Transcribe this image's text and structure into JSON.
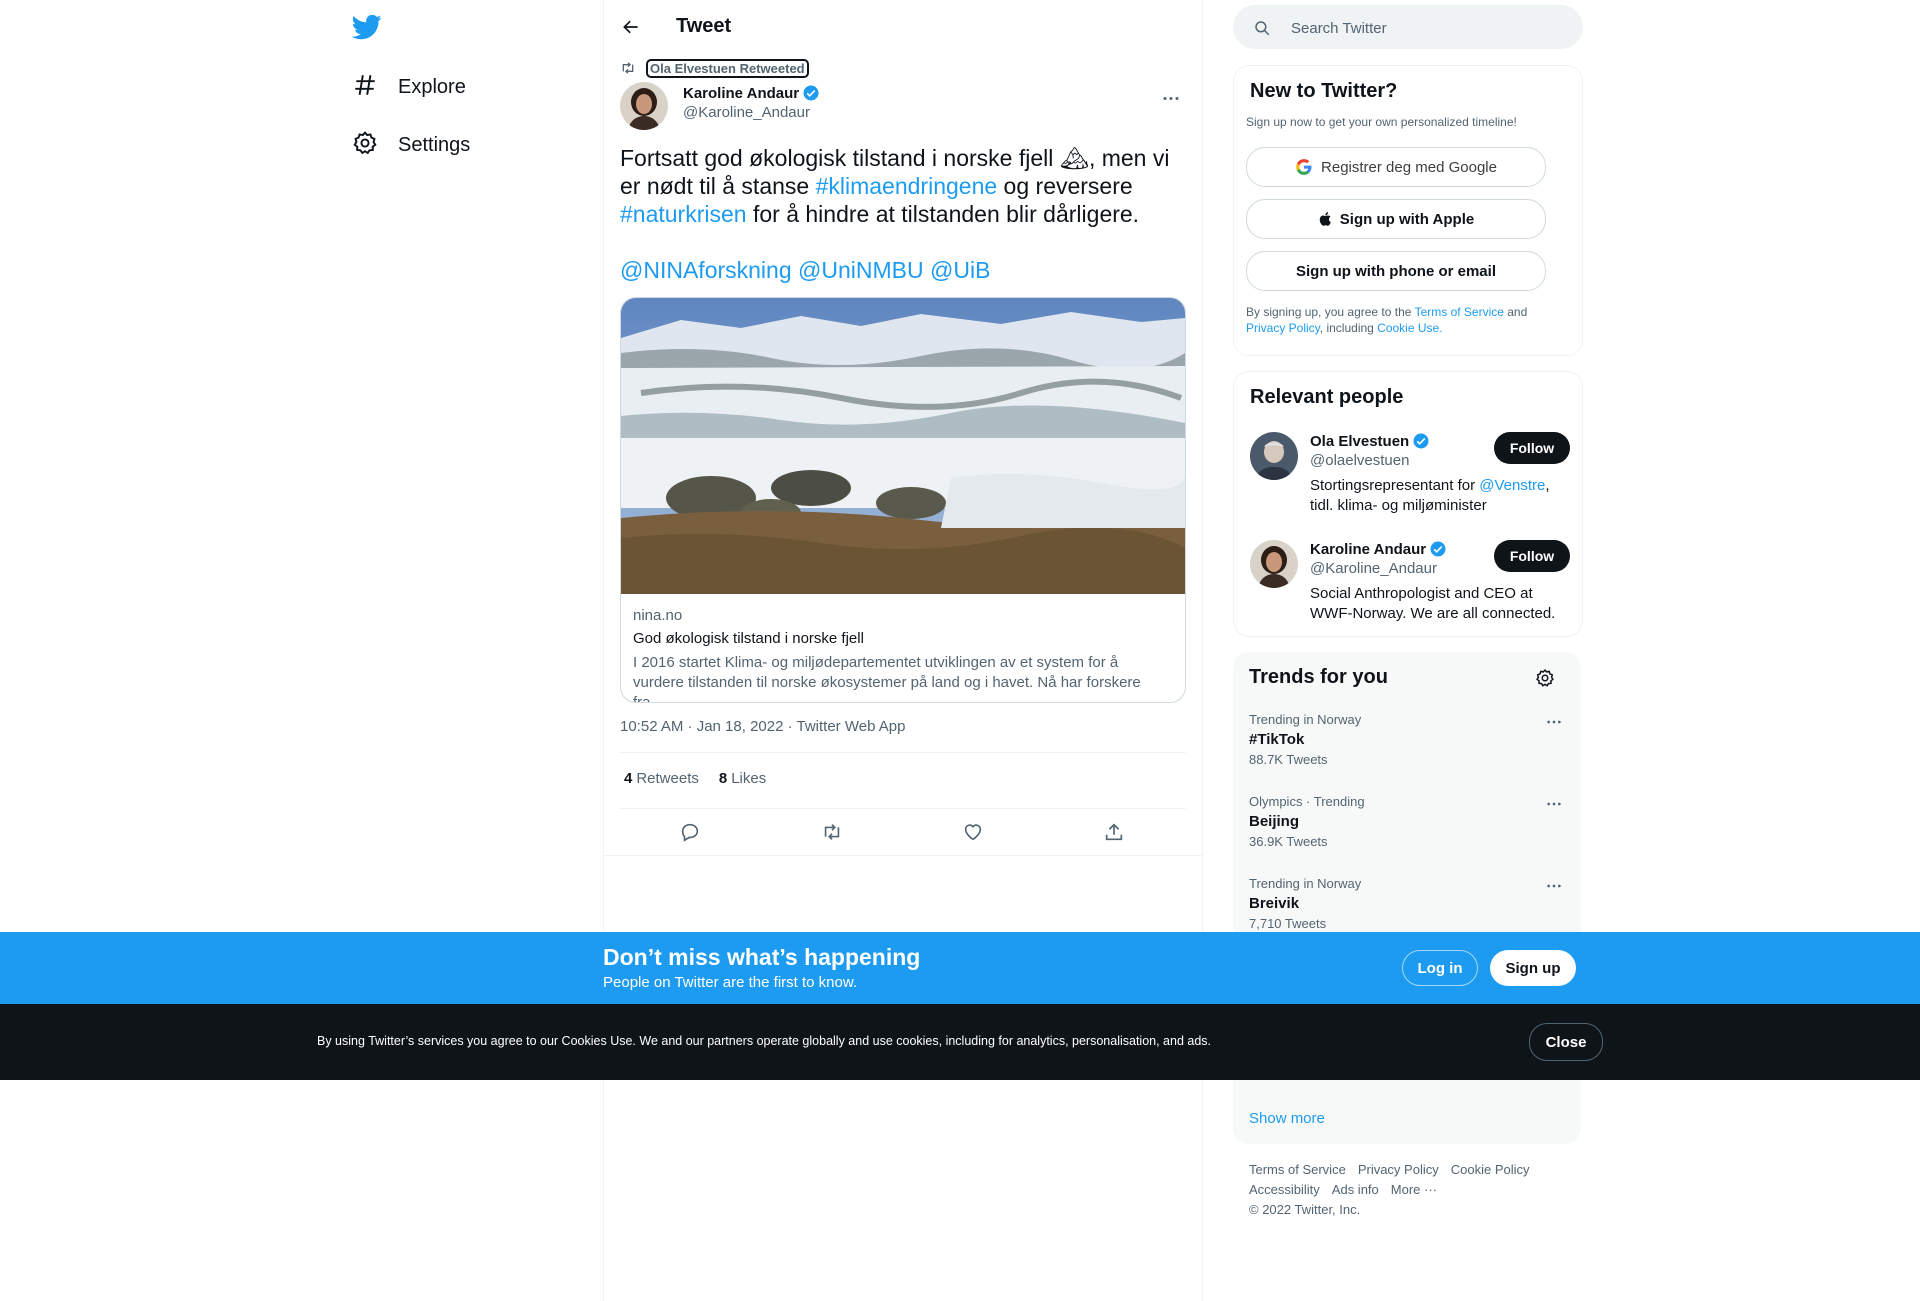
{
  "nav": {
    "items": [
      {
        "label": "Explore",
        "icon": "hashtag-icon"
      },
      {
        "label": "Settings",
        "icon": "gear-icon"
      }
    ]
  },
  "header": {
    "title": "Tweet"
  },
  "tweet": {
    "retweeted_by": "Ola Elvestuen Retweeted",
    "author_name": "Karoline Andaur",
    "author_handle": "@Karoline_Andaur",
    "text_1": "Fortsatt god økologisk tilstand i norske fjell ",
    "emoji": "🏔",
    "text_2": ", men vi er nødt til å stanse ",
    "hashtag_1": "#klimaendringene",
    "text_3": " og reversere ",
    "hashtag_2": "#naturkrisen",
    "text_4": " for å hindre at tilstanden blir dårligere.",
    "mention_1": "@NINAforskning",
    "mention_2": "@UniNMBU",
    "mention_3": "@UiB",
    "card": {
      "domain": "nina.no",
      "title": "God økologisk tilstand i norske fjell",
      "description": "I 2016 startet Klima- og miljødepartementet utviklingen av et system for å vurdere tilstanden til norske økosystemer på land og i havet. Nå har forskere fra..."
    },
    "meta": "10:52 AM · Jan 18, 2022 · Twitter Web App",
    "retweets_count": "4",
    "retweets_label": "Retweets",
    "likes_count": "8",
    "likes_label": "Likes"
  },
  "search": {
    "placeholder": "Search Twitter"
  },
  "new_to_twitter": {
    "title": "New to Twitter?",
    "subtitle": "Sign up now to get your own personalized timeline!",
    "google_btn": "Registrer deg med Google",
    "apple_btn": "Sign up with Apple",
    "phone_btn": "Sign up with phone or email",
    "legal_1": "By signing up, you agree to the ",
    "terms": "Terms of Service",
    "legal_2": " and ",
    "privacy": "Privacy Policy",
    "legal_3": ", including ",
    "cookie": "Cookie Use."
  },
  "relevant_people": {
    "title": "Relevant people",
    "people": [
      {
        "name": "Ola Elvestuen",
        "handle": "@olaelvestuen",
        "bio_1": "Stortingsrepresentant for ",
        "bio_link": "@Venstre",
        "bio_2": ", tidl. klima- og miljøminister",
        "follow": "Follow"
      },
      {
        "name": "Karoline Andaur",
        "handle": "@Karoline_Andaur",
        "bio_1": "Social Anthropologist and CEO at WWF-Norway. We are all connected.",
        "follow": "Follow"
      }
    ]
  },
  "trends": {
    "title": "Trends for you",
    "items": [
      {
        "context": "Trending in Norway",
        "name": "#TikTok",
        "count": "88.7K Tweets"
      },
      {
        "context": "Olympics · Trending",
        "name": "Beijing",
        "count": "36.9K Tweets"
      },
      {
        "context": "Trending in Norway",
        "name": "Breivik",
        "count": "7,710 Tweets"
      }
    ],
    "show_more": "Show more"
  },
  "footer": {
    "links_1": [
      "Terms of Service",
      "Privacy Policy",
      "Cookie Policy"
    ],
    "links_2": [
      "Accessibility",
      "Ads info",
      "More ···"
    ],
    "copyright": "© 2022 Twitter, Inc."
  },
  "signup_bar": {
    "title": "Don’t miss what’s happening",
    "subtitle": "People on Twitter are the first to know.",
    "login": "Log in",
    "signup": "Sign up"
  },
  "cookie_bar": {
    "text": "By using Twitter’s services you agree to our Cookies Use. We and our partners operate globally and use cookies, including for analytics, personalisation, and ads.",
    "close": "Close"
  },
  "colors": {
    "accent": "#1d9bf0",
    "text": "#0f1419",
    "muted": "#536471",
    "dark": "#0f1419"
  }
}
